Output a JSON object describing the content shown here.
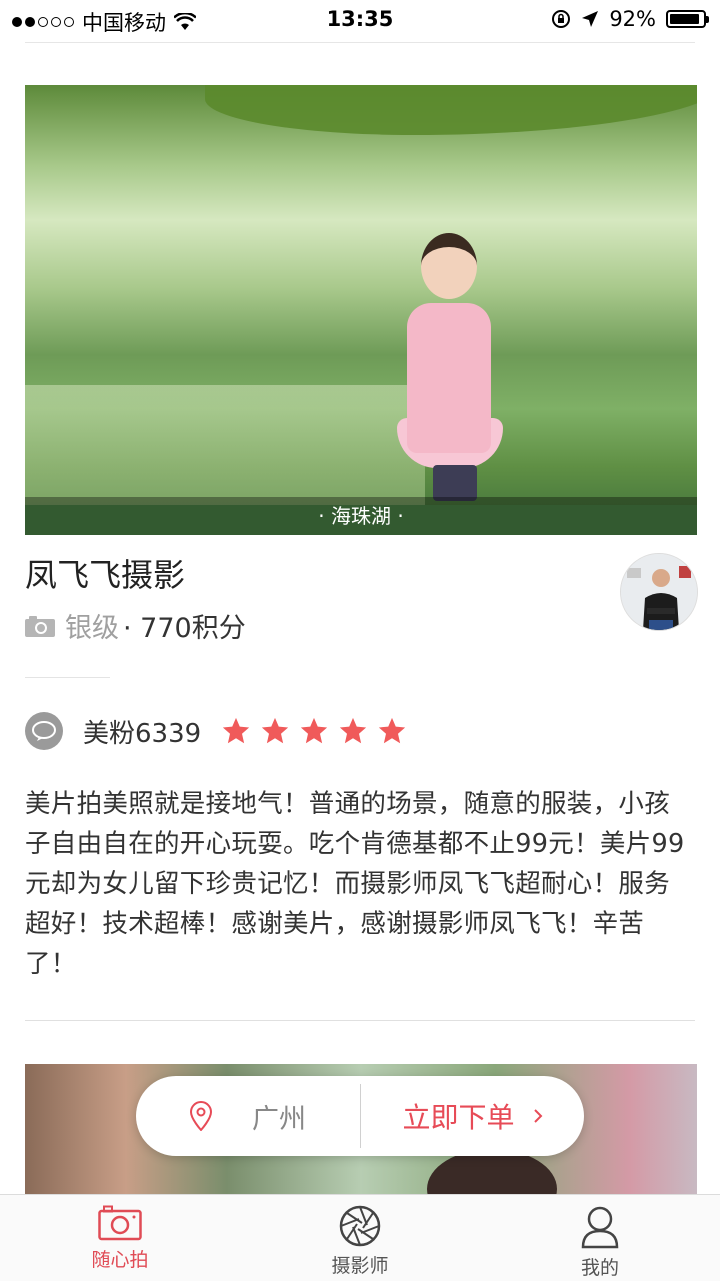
{
  "status_bar": {
    "carrier": "中国移动",
    "time": "13:35",
    "battery": "92%",
    "battery_level": 0.92,
    "signal_bars_filled": 2,
    "signal_bars_total": 5
  },
  "hero": {
    "caption": "· 海珠湖 ·"
  },
  "photographer": {
    "name": "凤飞飞摄影",
    "level": "银级",
    "points": "· 770积分"
  },
  "review": {
    "reviewer": "美粉6339",
    "rating": 5,
    "rating_max": 5,
    "text": "美片拍美照就是接地气！普通的场景，随意的服装，小孩子自由自在的开心玩耍。吃个肯德基都不止99元！美片99元却为女儿留下珍贵记忆！而摄影师凤飞飞超耐心！服务超好！技术超棒！感谢美片，感谢摄影师凤飞飞！辛苦了！"
  },
  "order_bar": {
    "city": "广州",
    "order_label": "立即下单"
  },
  "tabs": [
    {
      "label": "随心拍",
      "icon": "camera-icon",
      "active": true
    },
    {
      "label": "摄影师",
      "icon": "aperture-icon",
      "active": false
    },
    {
      "label": "我的",
      "icon": "user-icon",
      "active": false
    }
  ],
  "colors": {
    "accent": "#e04b55",
    "star": "#f05a5a"
  }
}
